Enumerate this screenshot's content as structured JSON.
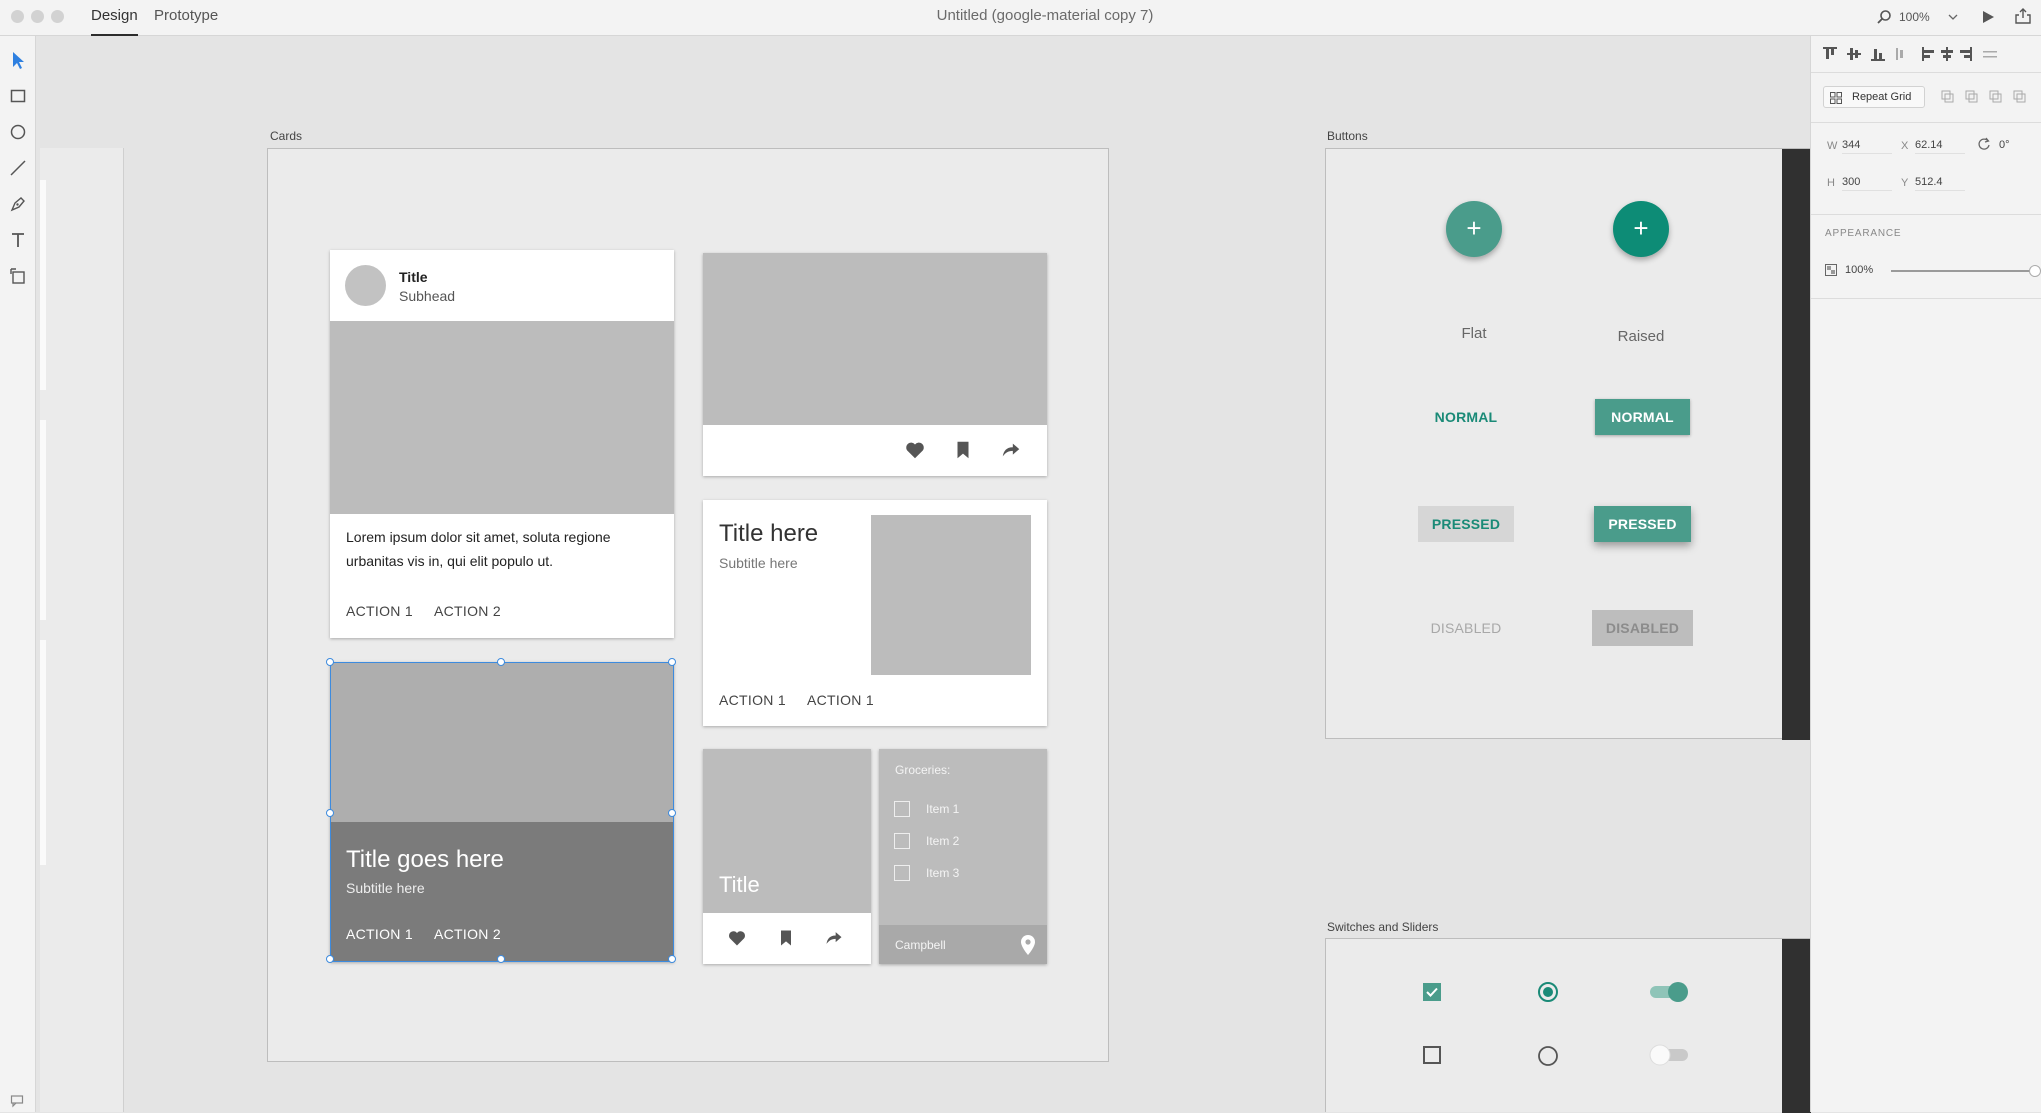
{
  "app": {
    "tabs": {
      "design": "Design",
      "prototype": "Prototype"
    },
    "document_title": "Untitled (google-material copy 7)",
    "zoom": "100%"
  },
  "icons": {
    "select": "select-arrow-icon",
    "rectangle": "rectangle-icon",
    "ellipse": "ellipse-icon",
    "line": "line-icon",
    "pen": "pen-icon",
    "text": "text-icon",
    "artboard": "artboard-icon",
    "search": "search-icon",
    "play": "play-icon",
    "share": "share-icon"
  },
  "colors": {
    "accent": "#1a8a77",
    "accent_muted": "#4a9c8b",
    "selection": "#3d8bde"
  },
  "artboards": {
    "cards": "Cards",
    "buttons": "Buttons",
    "switches": "Switches and Sliders"
  },
  "cards": {
    "card1": {
      "title": "Title",
      "subhead": "Subhead",
      "body": "Lorem ipsum dolor sit amet, soluta regione urbanitas vis in, qui elit populo ut.",
      "action1": "ACTION 1",
      "action2": "ACTION 2"
    },
    "card3": {
      "title": "Title here",
      "subtitle": "Subtitle here",
      "action1": "ACTION 1",
      "action2": "ACTION 1"
    },
    "card4": {
      "title": "Title goes here",
      "subtitle": "Subtitle here",
      "action1": "ACTION 1",
      "action2": "ACTION 2"
    },
    "card5": {
      "title": "Title"
    },
    "card6": {
      "heading": "Groceries:",
      "items": [
        "Item 1",
        "Item 2",
        "Item 3"
      ],
      "footer": "Campbell"
    }
  },
  "buttons": {
    "col_flat": "Flat",
    "col_raised": "Raised",
    "fab_label": "+",
    "normal": "NORMAL",
    "pressed": "PRESSED",
    "disabled": "DISABLED"
  },
  "panel": {
    "repeat_grid": "Repeat Grid",
    "w_label": "W",
    "w_value": "344",
    "x_label": "X",
    "x_value": "62.14",
    "rotation": "0°",
    "h_label": "H",
    "h_value": "300",
    "y_label": "Y",
    "y_value": "512.4",
    "appearance": "APPEARANCE",
    "opacity": "100%",
    "opacity_fraction": 1.0
  }
}
